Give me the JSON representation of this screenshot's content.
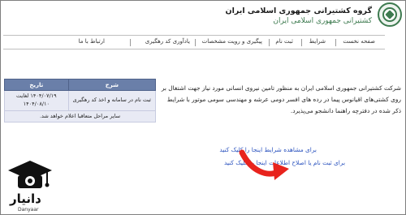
{
  "header": {
    "org_title": "گروه کشتیرانی جمهوری اسلامی ایران",
    "org_subtitle": "کشتیرانی جمهوری اسلامی ایران"
  },
  "nav": {
    "items": [
      "صفحه نخست",
      "شرایط",
      "ثبت نام",
      "پیگیری و رویت مشخصات",
      "یادآوری کد رهگیری",
      "ارتباط با ما"
    ]
  },
  "table": {
    "headers": [
      "شرح",
      "تاریخ"
    ],
    "rows": [
      [
        "ثبت نام در سامانه و اخذ کد رهگیری",
        "۱۴۰۴/۰۷/۱۹ لغایت ۱۴۰۴/۰۸/۱۰"
      ]
    ],
    "footer": "سایر مراحل متعاقبا اعلام خواهد شد."
  },
  "body": {
    "paragraph": "شرکت کشتیرانی جمهوری اسلامی ایران به منظور تامین نیروی انسانی مورد نیاز جهت اشتغال بر روی کشتی‌های اقیانوس پیما در رده های افسر دومی عرشه و مهندسی سومی موتور با شرایط ذکر شده در دفترچه راهنما دانشجو می‌پذیرد."
  },
  "links": {
    "view_conditions": "برای مشاهده شرایط اینجا را کلیک کنید",
    "register": "برای ثبت نام یا اصلاح اطلاعات اینجا را کلیک کنید"
  },
  "brand": {
    "name": "دانیار",
    "latin": "Danyaar"
  },
  "colors": {
    "table_header": "#6a7fa9",
    "table_cell": "#e8eaf4",
    "link": "#2a52be",
    "arrow": "#e8231d",
    "logo_green": "#3d7a4f"
  }
}
